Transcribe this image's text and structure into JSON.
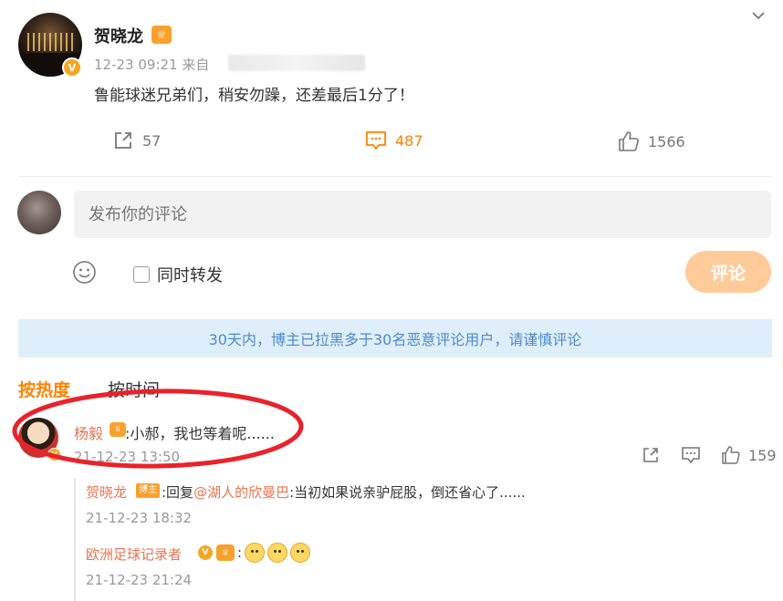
{
  "post": {
    "author": "贺晓龙",
    "crown_badge": "♕",
    "verified_badge": "V",
    "timestamp": "12-23 09:21",
    "source_prefix": "来自",
    "text": "鲁能球迷兄弟们，稍安勿躁，还差最后1分了！",
    "actions": {
      "share_count": "57",
      "comment_count": "487",
      "like_count": "1566"
    }
  },
  "composer": {
    "placeholder": "发布你的评论",
    "repost_label": "同时转发",
    "submit_label": "评论"
  },
  "notice": "30天内，博主已拉黑多于30名恶意评论用户，请谨慎评论",
  "sort_tabs": {
    "hot": "按热度",
    "time": "按时间"
  },
  "comments": [
    {
      "user": "杨毅",
      "text": ":小郝，我也等着呢......",
      "time": "21-12-23 13:50",
      "like_count": "159",
      "replies": [
        {
          "user": "贺晓龙",
          "tag": "博主",
          "prefix": ":回复",
          "mention": "@湖人的欣曼巴",
          "text": ":当初如果说亲驴屁股，倒还省心了......",
          "time": "21-12-23 18:32"
        },
        {
          "user": "欧洲足球记录者",
          "suffix": ":",
          "time": "21-12-23 21:24"
        }
      ]
    }
  ],
  "colors": {
    "accent_orange": "#ff8200",
    "username": "#eb7350",
    "notice_bg": "#dfeefb",
    "notice_text": "#4a8bc9",
    "annotation_red": "#e8232b"
  }
}
